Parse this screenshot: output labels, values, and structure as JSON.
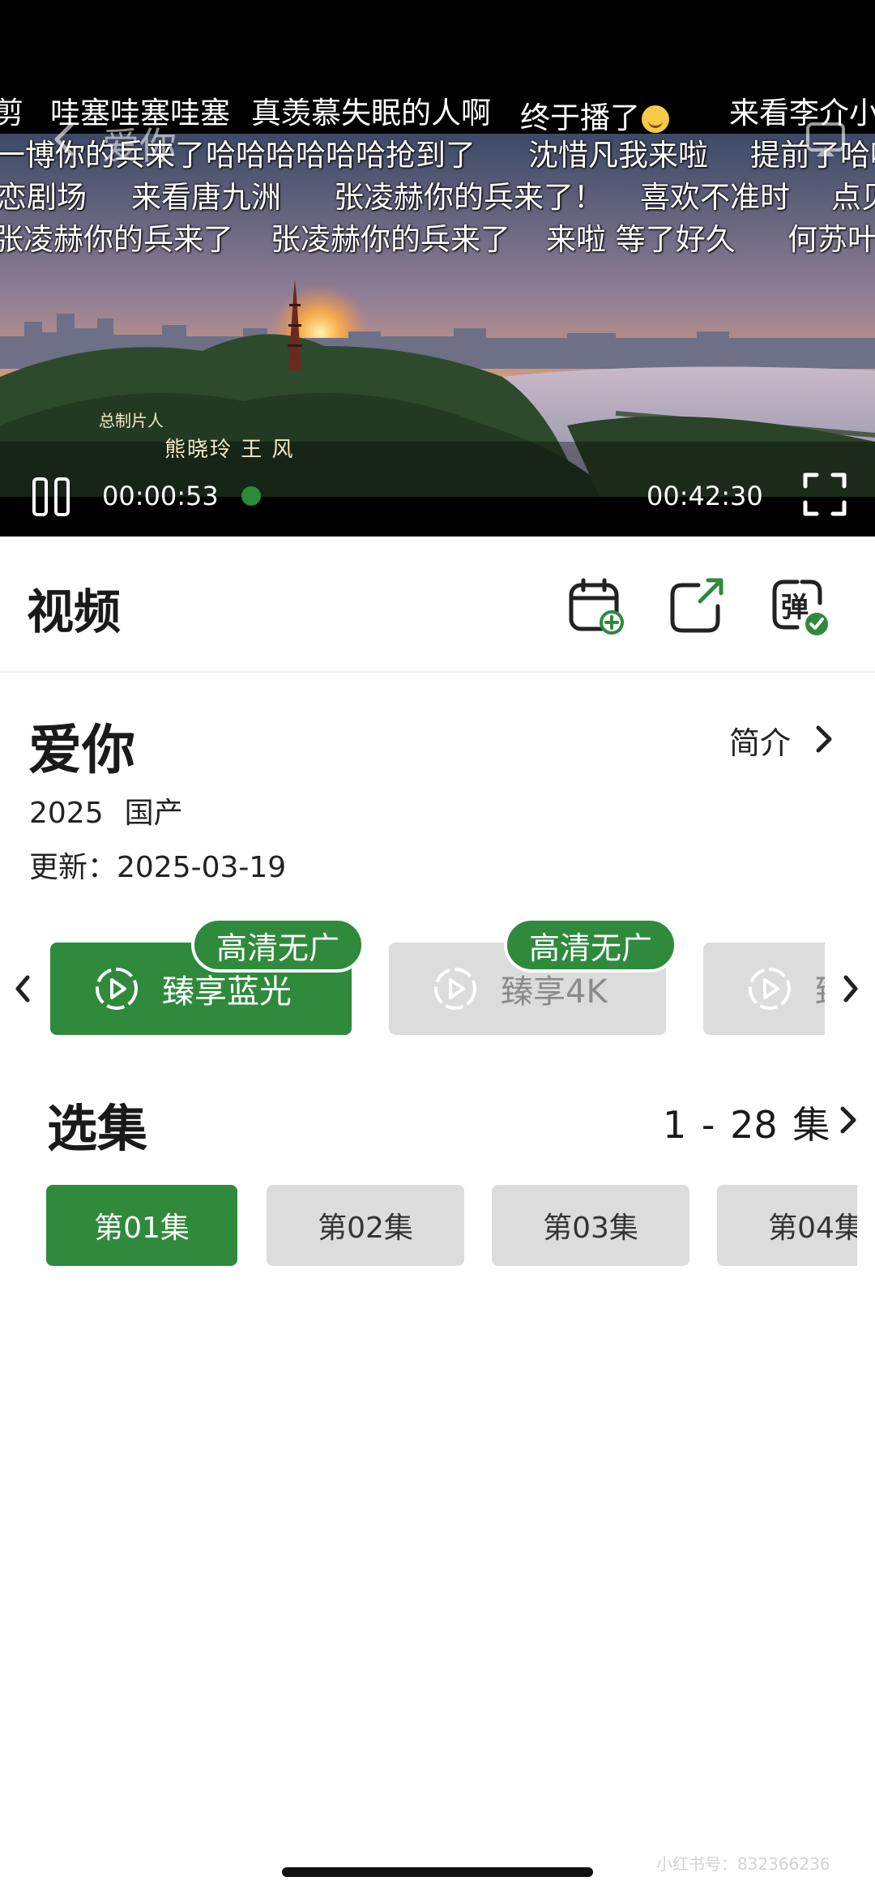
{
  "player": {
    "title": "爱你",
    "current_time": "00:00:53",
    "total_time": "00:42:30",
    "credit_role": "总制片人",
    "credit_names": "熊晓玲 王 风",
    "danmaku": {
      "row1": [
        "剪",
        "哇塞哇塞哇塞",
        "真羡慕失眠的人啊",
        "终于播了",
        "来看李介小"
      ],
      "row2": [
        "一博你的兵来了",
        "哈哈哈哈哈哈抢到了",
        "沈惜凡我来啦",
        "提前了哈哈"
      ],
      "row3": [
        "恋剧场",
        "来看唐九洲",
        "张凌赫你的兵来了！",
        "喜欢不准时",
        "点贝"
      ],
      "row4": [
        "张凌赫你的兵来了",
        "张凌赫你的兵来了",
        "来啦 等了好久",
        "何苏叶"
      ]
    }
  },
  "toolbar": {
    "title": "视频",
    "danmaku_toggle_label": "弹"
  },
  "show": {
    "title": "爱你",
    "intro_label": "简介",
    "year": "2025",
    "region": "国产",
    "updated": "更新：2025-03-19"
  },
  "quality": {
    "options": [
      {
        "label": "臻享蓝光",
        "badge": "高清无广",
        "selected": true
      },
      {
        "label": "臻享4K",
        "badge": "高清无广",
        "selected": false
      },
      {
        "label": "臻",
        "badge": "",
        "selected": false
      }
    ]
  },
  "episodes": {
    "header": "选集",
    "range": "1 - 28 集",
    "items": [
      "第01集",
      "第02集",
      "第03集",
      "第04集"
    ],
    "selected_index": 0
  },
  "watermark": "小红书号：832366236",
  "colors": {
    "accent": "#2f8a3c",
    "inactive_chip": "#dcdcdc",
    "player_bg": "#000000"
  },
  "icons": [
    "back-icon",
    "cast-icon",
    "pause-icon",
    "fullscreen-icon",
    "add-to-calendar-icon",
    "share-icon",
    "danmaku-icon",
    "chevron-right-icon",
    "chevron-left-icon",
    "play-circle-icon"
  ]
}
